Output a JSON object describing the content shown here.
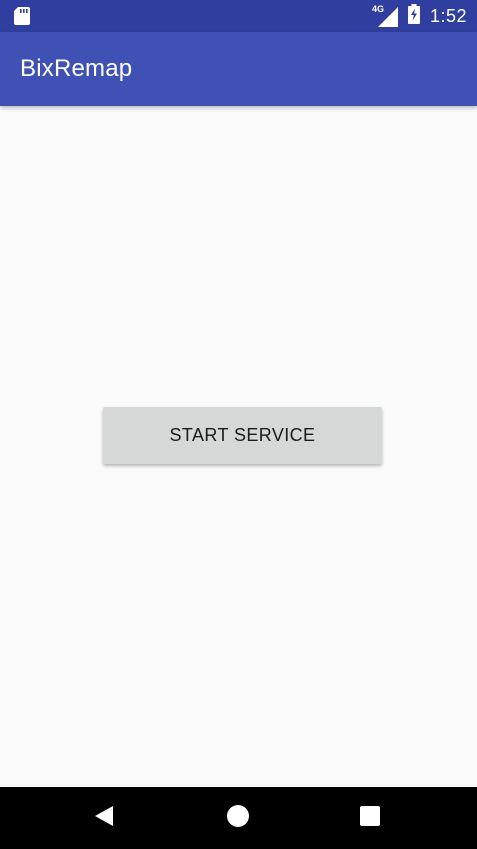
{
  "status_bar": {
    "sd_card_icon": "sd-card-icon",
    "network_label": "4G",
    "signal_icon": "signal-icon",
    "battery_icon": "battery-charging-icon",
    "time": "1:52"
  },
  "app_bar": {
    "title": "BixRemap"
  },
  "main": {
    "start_button_label": "START SERVICE"
  },
  "nav_bar": {
    "back_icon": "back-icon",
    "home_icon": "home-icon",
    "recents_icon": "recents-icon"
  },
  "colors": {
    "status_bar": "#303f9f",
    "app_bar": "#3f51b5",
    "background": "#fafafa",
    "button": "#d6d7d7",
    "nav_bar": "#000000"
  }
}
